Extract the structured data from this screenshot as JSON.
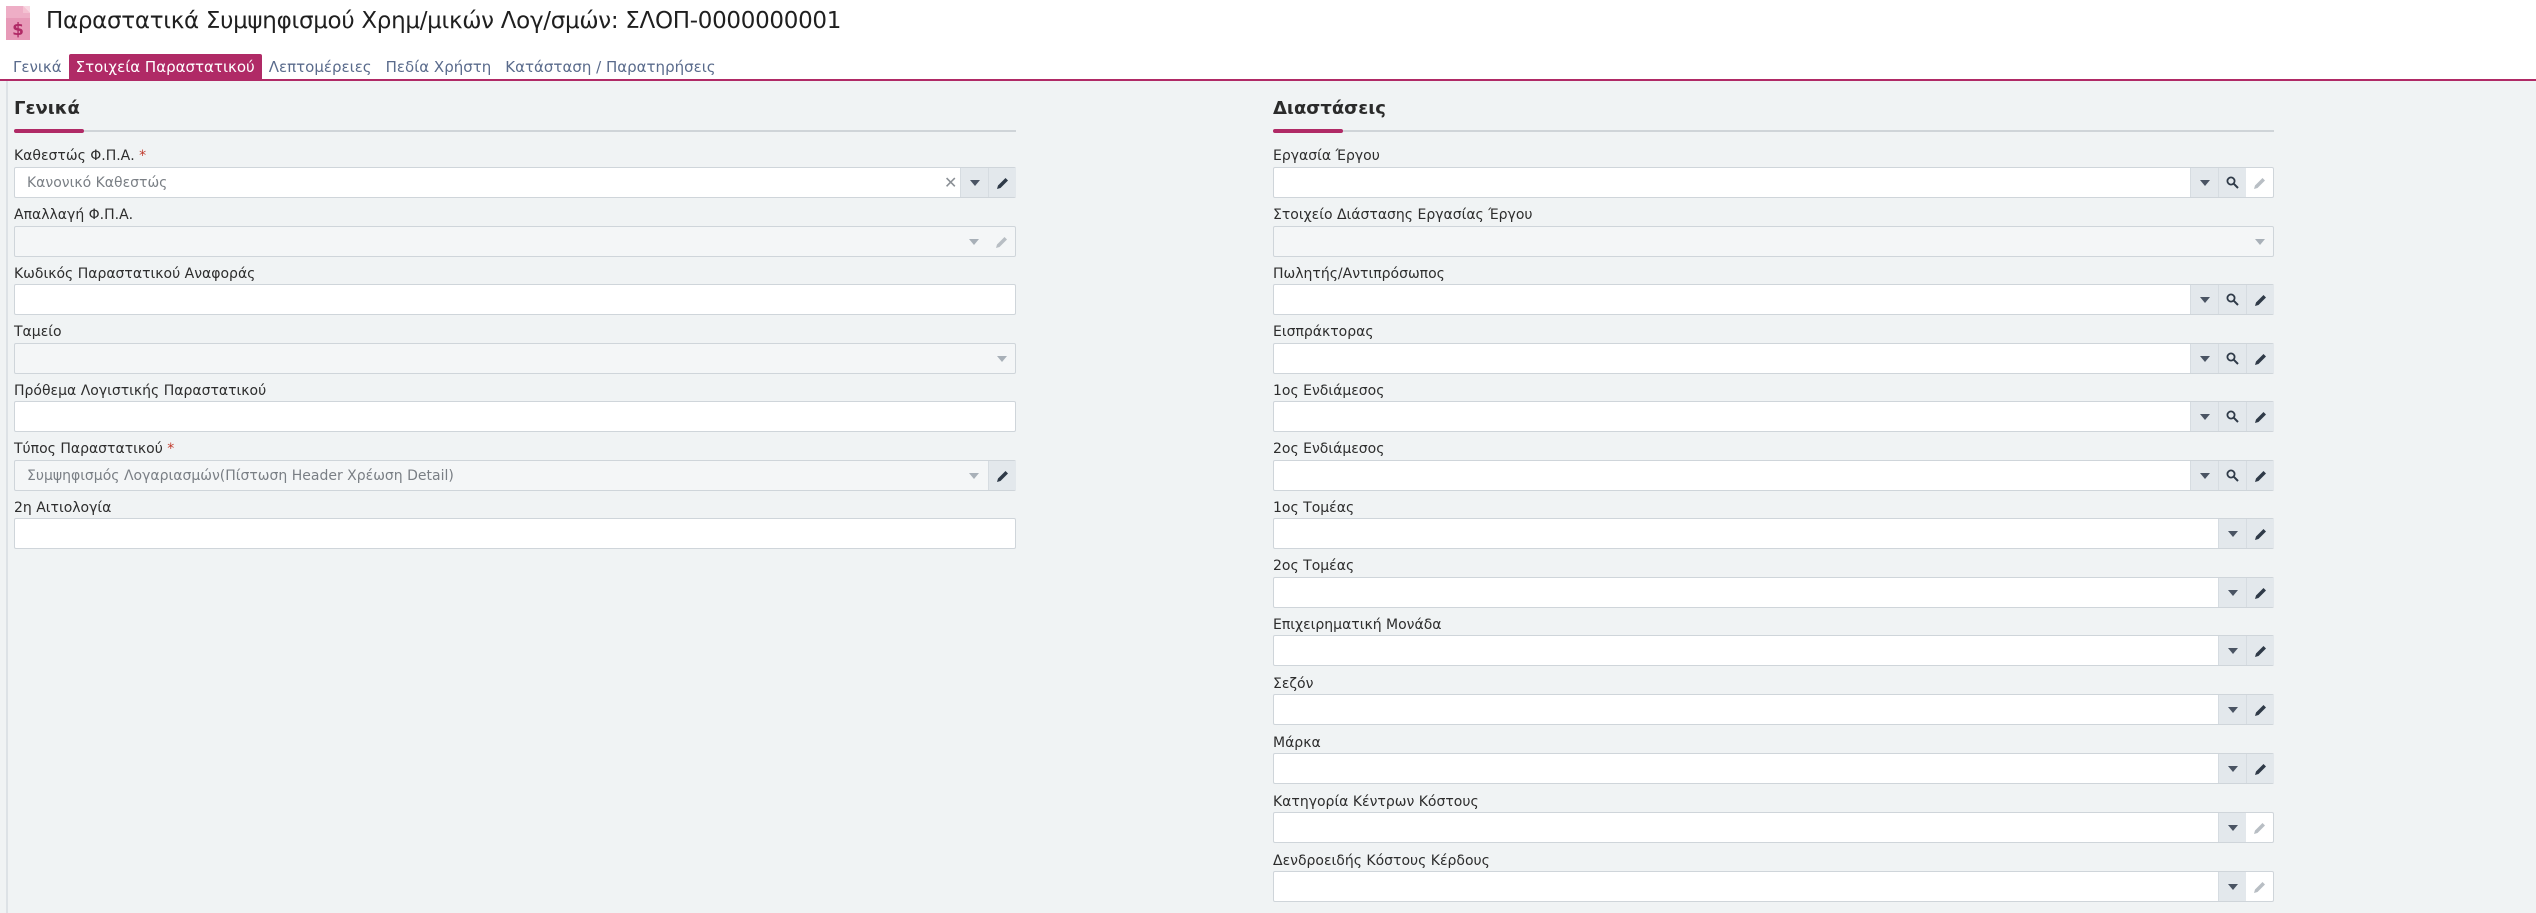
{
  "header": {
    "title": "Παραστατικά Συμψηφισμού Χρημ/μικών Λογ/σμών: ΣΛΟΠ-0000000001",
    "icon": "dollar-document-icon"
  },
  "tabs": [
    {
      "label": "Γενικά",
      "active": false
    },
    {
      "label": "Στοιχεία Παραστατικού",
      "active": true
    },
    {
      "label": "Λεπτομέρειες",
      "active": false
    },
    {
      "label": "Πεδία Χρήστη",
      "active": false
    },
    {
      "label": "Κατάσταση / Παρατηρήσεις",
      "active": false
    }
  ],
  "general": {
    "title": "Γενικά",
    "fields": [
      {
        "label": "Καθεστώς Φ.Π.Α.",
        "value": "Κανονικό Καθεστώς",
        "required": true
      },
      {
        "label": "Απαλλαγή Φ.Π.Α.",
        "value": ""
      },
      {
        "label": "Κωδικός Παραστατικού Αναφοράς",
        "value": ""
      },
      {
        "label": "Ταμείο",
        "value": ""
      },
      {
        "label": "Πρόθεμα Λογιστικής Παραστατικού",
        "value": ""
      },
      {
        "label": "Τύπος Παραστατικού",
        "value": "Συμψηφισμός Λογαριασμών(Πίστωση Header Χρέωση Detail)",
        "required": true
      },
      {
        "label": "2η Αιτιολογία",
        "value": ""
      }
    ]
  },
  "dimensions": {
    "title": "Διαστάσεις",
    "fields": [
      {
        "label": "Εργασία Έργου",
        "value": ""
      },
      {
        "label": "Στοιχείο Διάστασης Εργασίας Έργου",
        "value": ""
      },
      {
        "label": "Πωλητής/Αντιπρόσωπος",
        "value": ""
      },
      {
        "label": "Εισπράκτορας",
        "value": ""
      },
      {
        "label": "1ος Ενδιάμεσος",
        "value": ""
      },
      {
        "label": "2ος Ενδιάμεσος",
        "value": ""
      },
      {
        "label": "1ος Τομέας",
        "value": ""
      },
      {
        "label": "2ος Τομέας",
        "value": ""
      },
      {
        "label": "Επιχειρηματική Μονάδα",
        "value": ""
      },
      {
        "label": "Σεζόν",
        "value": ""
      },
      {
        "label": "Μάρκα",
        "value": ""
      },
      {
        "label": "Κατηγορία Κέντρων Κόστους",
        "value": ""
      },
      {
        "label": "Δενδροειδής Κόστους Κέρδους",
        "value": ""
      }
    ]
  },
  "icons": {
    "dropdown": "chevron-down-icon",
    "search": "search-icon",
    "edit": "pencil-icon",
    "clear": "close-icon"
  },
  "colors": {
    "accent": "#b02a66",
    "background": "#f0f3f4"
  }
}
